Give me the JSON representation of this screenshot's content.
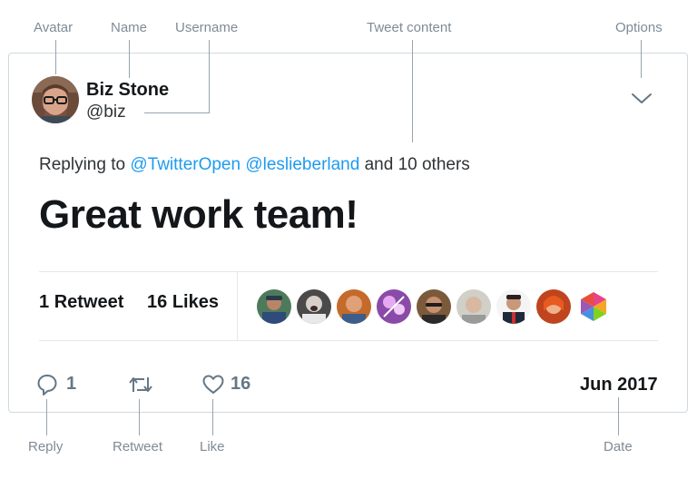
{
  "callouts": {
    "avatar": "Avatar",
    "name": "Name",
    "username": "Username",
    "tweet_content": "Tweet content",
    "options": "Options",
    "reply": "Reply",
    "retweet": "Retweet",
    "like": "Like",
    "date": "Date"
  },
  "tweet": {
    "display_name": "Biz Stone",
    "username": "@biz",
    "replying_prefix": "Replying to",
    "mentions": [
      "@TwitterOpen",
      "@leslieberland"
    ],
    "replying_suffix": "and 10 others",
    "text": "Great work team!",
    "retweet_count": "1",
    "retweet_label": "Retweet",
    "like_count": "16",
    "like_label": "Likes",
    "reply_action_count": "1",
    "like_action_count": "16",
    "date": "Jun 2017"
  },
  "colors": {
    "mention": "#1d9bf0",
    "border": "#cfd9de",
    "callout_text": "#7f8b96",
    "action_icon": "#657786"
  },
  "icons": {
    "options": "chevron-down-icon",
    "reply": "reply-icon",
    "retweet": "retweet-icon",
    "like": "heart-icon"
  },
  "likers_count": 9
}
